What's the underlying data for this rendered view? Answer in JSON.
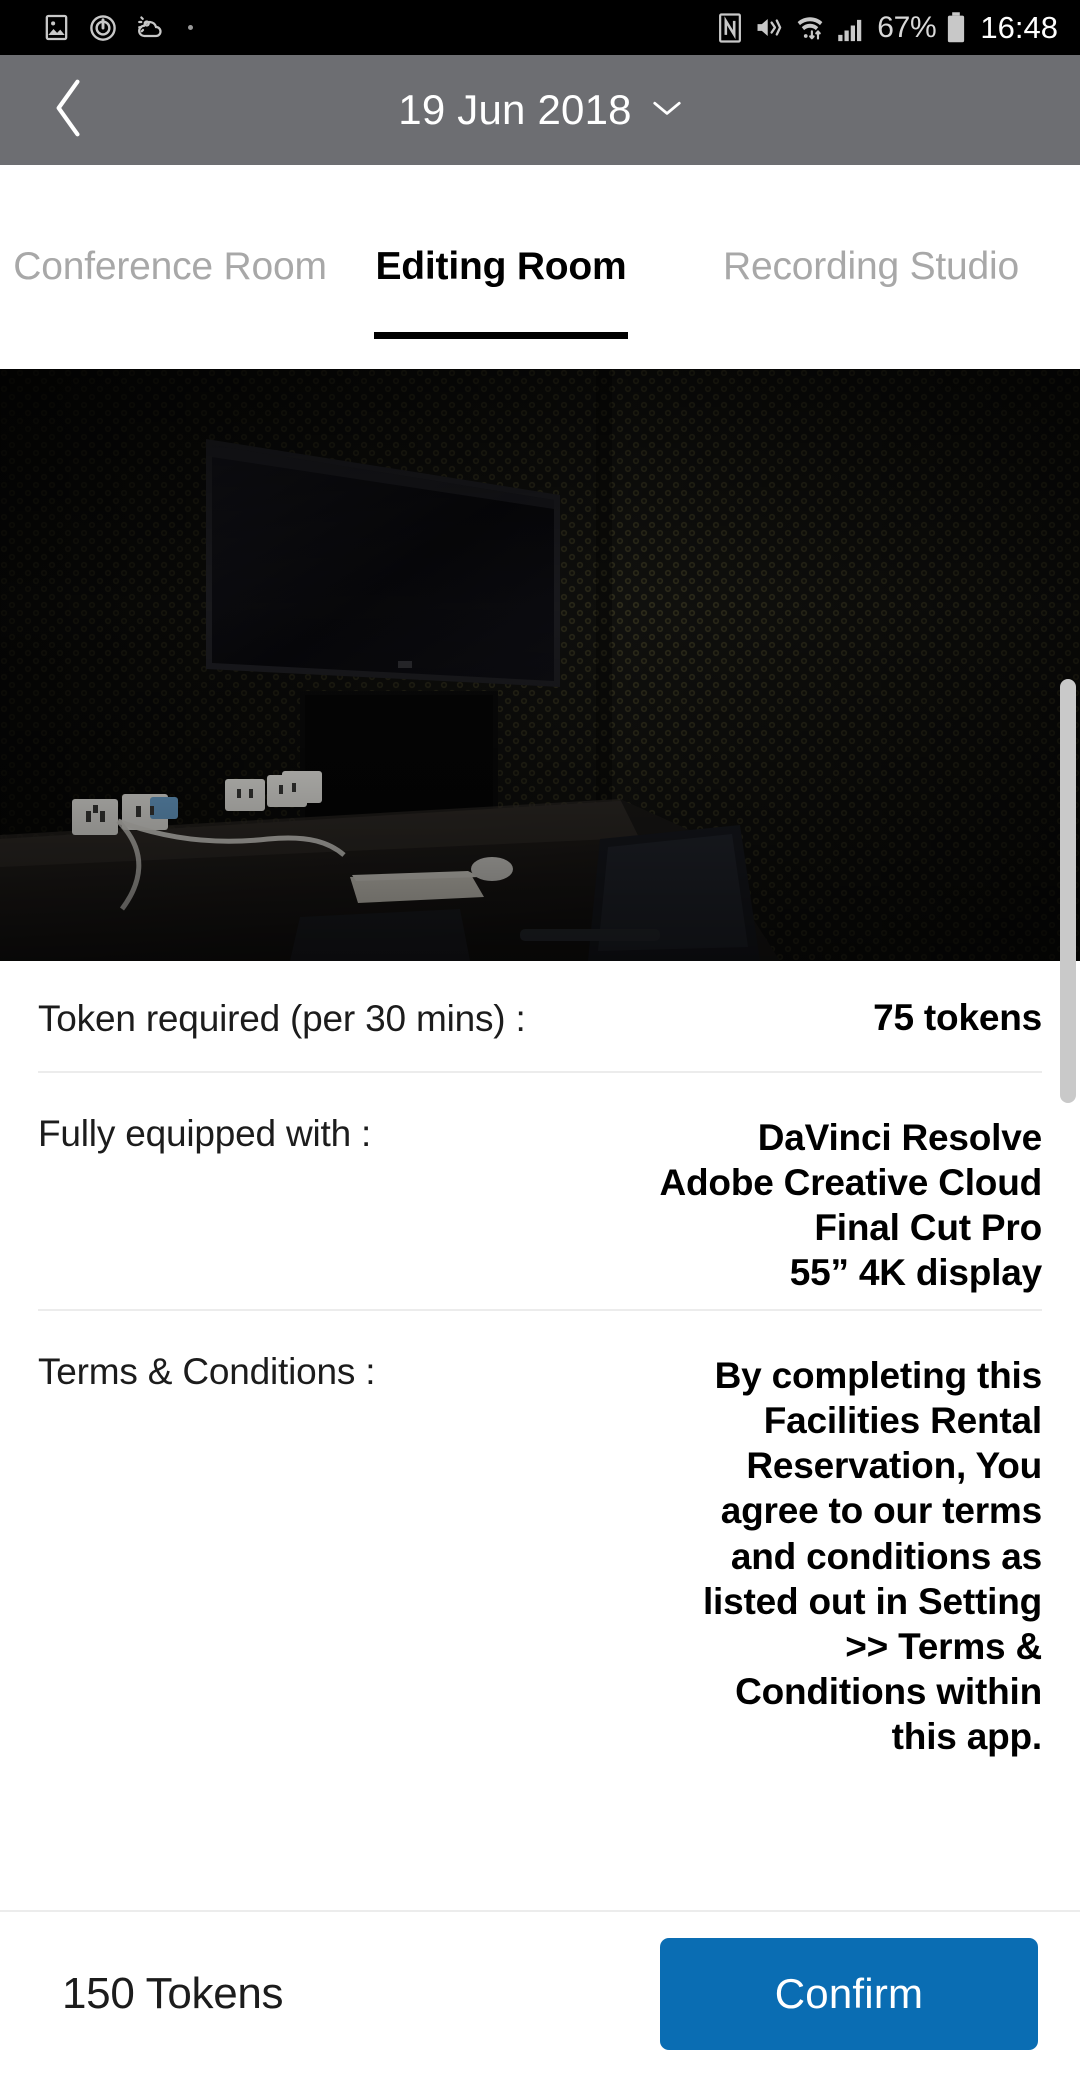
{
  "statusbar": {
    "left_icons": [
      "image-icon",
      "alarm-circle-icon",
      "weather-icon",
      "dot-indicator"
    ],
    "right_icons": [
      "nfc-icon",
      "vibrate-mute-icon",
      "wifi-icon",
      "signal-bars-icon",
      "battery-icon"
    ],
    "battery_percent": "67%",
    "clock": "16:48"
  },
  "appbar": {
    "back_label": "back",
    "title": "19 Jun 2018",
    "dropdown_icon": "chevron-down-icon"
  },
  "tabs": [
    {
      "label": "Conference Room",
      "active": false
    },
    {
      "label": "Editing Room",
      "active": true
    },
    {
      "label": "Recording Studio",
      "active": false
    }
  ],
  "hero": {
    "alt": "Editing room with wall mounted TV, iMac on dark desk and acoustic foam walls"
  },
  "details": {
    "token": {
      "label": "Token required (per 30 mins) :",
      "value": "75 tokens"
    },
    "equipment": {
      "label": "Fully equipped with :",
      "value": "DaVinci Resolve\nAdobe Creative Cloud\nFinal Cut Pro\n55”  4K display"
    },
    "terms": {
      "label": "Terms & Conditions :",
      "value": "By completing this Facilities Rental Reservation, You agree to our terms and conditions as listed out in Setting >> Terms & Conditions within this app."
    }
  },
  "bottombar": {
    "total": "150 Tokens",
    "confirm_label": "Confirm"
  },
  "colors": {
    "appbar_bg": "#6d6e72",
    "accent_blue": "#0a6db3",
    "tab_inactive": "#a8a8a8",
    "divider": "#ececec"
  }
}
